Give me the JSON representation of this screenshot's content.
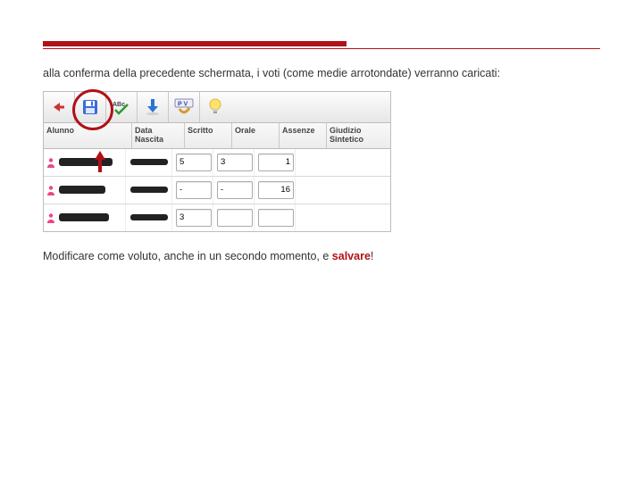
{
  "intro_text": "alla conferma della precedente schermata, i voti (come medie arrotondate) verranno caricati:",
  "outro_text_pre": "Modificare come voluto, anche in un secondo momento, e ",
  "outro_text_emph": "salvare",
  "outro_text_post": "!",
  "toolbar": {
    "buttons": [
      {
        "name": "back-arrow-icon"
      },
      {
        "name": "save-disk-icon",
        "highlight": true
      },
      {
        "name": "abc-spellcheck-icon"
      },
      {
        "name": "download-arrow-icon"
      },
      {
        "name": "pv-badge-icon"
      },
      {
        "name": "lightbulb-icon"
      }
    ]
  },
  "columns": {
    "alunno": "Alunno",
    "data_nascita": "Data Nascita",
    "scritto": "Scritto",
    "orale": "Orale",
    "assenze": "Assenze",
    "giudizio": "Giudizio Sintetico"
  },
  "rows": [
    {
      "scritto": "5",
      "orale": "3",
      "assenze": "1"
    },
    {
      "scritto": "-",
      "orale": "-",
      "assenze": "16"
    },
    {
      "scritto": "3",
      "orale": "",
      "assenze": ""
    }
  ]
}
